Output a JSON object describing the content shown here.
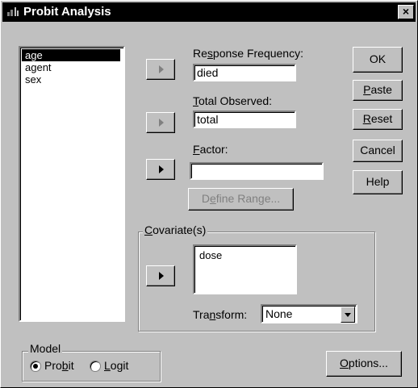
{
  "window": {
    "title": "Probit Analysis",
    "close_label": "×"
  },
  "variables": [
    "age",
    "agent",
    "sex"
  ],
  "response_frequency": {
    "label_pre": "Re",
    "label_u": "s",
    "label_post": "ponse Frequency:",
    "value": "died"
  },
  "total_observed": {
    "label_u": "T",
    "label_post": "otal Observed:",
    "value": "total"
  },
  "factor": {
    "label_u": "F",
    "label_post": "actor:",
    "value": ""
  },
  "define_range": {
    "pre": "D",
    "u": "e",
    "post": "fine Range..."
  },
  "covariates": {
    "label_u": "C",
    "label_post": "ovariate(s)",
    "items": [
      "dose"
    ],
    "transform_pre": "Tra",
    "transform_u": "n",
    "transform_post": "sform:",
    "transform_value": "None"
  },
  "buttons": {
    "ok": "OK",
    "paste_u": "P",
    "paste_post": "aste",
    "reset_u": "R",
    "reset_post": "eset",
    "cancel": "Cancel",
    "help": "Help",
    "options_u": "O",
    "options_post": "ptions..."
  },
  "model": {
    "label": "Model",
    "probit_pre": "Pro",
    "probit_u": "b",
    "probit_post": "it",
    "logit_u": "L",
    "logit_post": "ogit",
    "selected": "Probit"
  }
}
